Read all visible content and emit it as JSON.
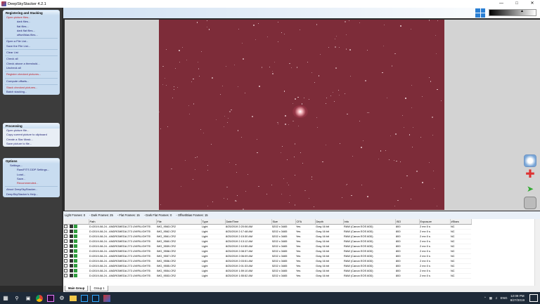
{
  "window": {
    "title": "DeepSkyStacker 4.2.1"
  },
  "sidebar": {
    "registering": {
      "heading": "Registering and Stacking",
      "items": [
        {
          "label": "Open picture files...",
          "indent": 0,
          "red": true
        },
        {
          "label": "dark files...",
          "indent": 2
        },
        {
          "label": "flat files...",
          "indent": 2
        },
        {
          "label": "dark flat files...",
          "indent": 2
        },
        {
          "label": "offset/bias files...",
          "indent": 2
        },
        {
          "sep": true
        },
        {
          "label": "Open a File List...",
          "indent": 0
        },
        {
          "label": "Save the File List...",
          "indent": 0
        },
        {
          "sep": true
        },
        {
          "label": "Clear List",
          "indent": 0
        },
        {
          "sep": true
        },
        {
          "label": "Check all",
          "indent": 0
        },
        {
          "label": "Check above a threshold...",
          "indent": 0
        },
        {
          "label": "Uncheck all",
          "indent": 0
        },
        {
          "sep": true
        },
        {
          "label": "Register checked pictures...",
          "indent": 0,
          "red": true
        },
        {
          "sep": true
        },
        {
          "label": "Compute offsets...",
          "indent": 0
        },
        {
          "sep": true
        },
        {
          "label": "Stack checked pictures...",
          "indent": 0,
          "red": true
        },
        {
          "label": "Batch stacking...",
          "indent": 0
        }
      ]
    },
    "processing": {
      "heading": "Processing",
      "items": [
        {
          "label": "Open picture file...",
          "indent": 0
        },
        {
          "label": "Copy current picture to clipboard",
          "indent": 0
        },
        {
          "label": "Create a Star Mask...",
          "indent": 0
        },
        {
          "label": "Save picture to file...",
          "indent": 0
        }
      ]
    },
    "options": {
      "heading": "Options",
      "items": [
        {
          "label": "Settings...",
          "indent": 1
        },
        {
          "label": "Raw/FITS DDP Settings...",
          "indent": 2
        },
        {
          "label": "Load...",
          "indent": 2
        },
        {
          "label": "Save...",
          "indent": 2
        },
        {
          "label": "Recommended...",
          "indent": 2,
          "red": true
        },
        {
          "sep": true
        },
        {
          "label": "About DeepSkyStacker...",
          "indent": 0
        },
        {
          "label": "DeepSkyStacker's Help...",
          "indent": 0
        }
      ]
    }
  },
  "frames_bar": {
    "light": "Light Frames: 0",
    "dark": "Dark Frames: 25",
    "flat": "Flat Frames: 15",
    "darkflat": "Dark Flat Frames: 0",
    "offset": "Offset/Bias Frames: 15"
  },
  "table": {
    "columns": [
      "Path",
      "File",
      "Type",
      "Date/Time",
      "Size",
      "CFA",
      "Depth",
      "Info",
      "ISO",
      "Exposure",
      "#Stars"
    ],
    "rows": [
      [
        "D:\\2019-08-24 - ANDROMEDA 273 UVIR\\LIGHTS\\",
        "IMG_9563.CR2",
        "Light",
        "8/25/2019 2:20:06 AM",
        "5202 x 3465",
        "Yes",
        "Gray 16 bit",
        "RAW (Canon EOS 60D)",
        "800",
        "2 mn 0 s",
        "NC"
      ],
      [
        "D:\\2019-08-24 - ANDROMEDA 273 UVIR\\LIGHTS\\",
        "IMG_9562.CR2",
        "Light",
        "8/25/2019 2:17:48 AM",
        "5202 x 3465",
        "Yes",
        "Gray 16 bit",
        "RAW (Canon EOS 60D)",
        "800",
        "2 mn 0 s",
        "NC"
      ],
      [
        "D:\\2019-08-24 - ANDROMEDA 273 UVIR\\LIGHTS\\",
        "IMG_9561.CR2",
        "Light",
        "8/25/2019 2:15:30 AM",
        "5202 x 3465",
        "Yes",
        "Gray 16 bit",
        "RAW (Canon EOS 60D)",
        "800",
        "2 mn 0 s",
        "NC"
      ],
      [
        "D:\\2019-08-24 - ANDROMEDA 273 UVIR\\LIGHTS\\",
        "IMG_9560.CR2",
        "Light",
        "8/25/2019 2:13:12 AM",
        "5202 x 3465",
        "Yes",
        "Gray 16 bit",
        "RAW (Canon EOS 60D)",
        "800",
        "2 mn 0 s",
        "NC"
      ],
      [
        "D:\\2019-08-24 - ANDROMEDA 273 UVIR\\LIGHTS\\",
        "IMG_9559.CR2",
        "Light",
        "8/25/2019 2:10:55 AM",
        "5202 x 3465",
        "Yes",
        "Gray 16 bit",
        "RAW (Canon EOS 60D)",
        "800",
        "2 mn 0 s",
        "NC"
      ],
      [
        "D:\\2019-08-24 - ANDROMEDA 273 UVIR\\LIGHTS\\",
        "IMG_9558.CR2",
        "Light",
        "8/25/2019 2:08:37 AM",
        "5202 x 3465",
        "Yes",
        "Gray 16 bit",
        "RAW (Canon EOS 60D)",
        "800",
        "2 mn 0 s",
        "NC"
      ],
      [
        "D:\\2019-08-24 - ANDROMEDA 273 UVIR\\LIGHTS\\",
        "IMG_9557.CR2",
        "Light",
        "8/25/2019 2:06:09 AM",
        "5202 x 3465",
        "Yes",
        "Gray 16 bit",
        "RAW (Canon EOS 60D)",
        "800",
        "2 mn 0 s",
        "NC"
      ],
      [
        "D:\\2019-08-24 - ANDROMEDA 273 UVIR\\LIGHTS\\",
        "IMG_9556.CR2",
        "Light",
        "8/25/2019 2:03:51 AM",
        "5202 x 3465",
        "Yes",
        "Gray 16 bit",
        "RAW (Canon EOS 60D)",
        "800",
        "2 mn 0 s",
        "NC"
      ],
      [
        "D:\\2019-08-24 - ANDROMEDA 273 UVIR\\LIGHTS\\",
        "IMG_9555.CR2",
        "Light",
        "8/25/2019 2:01:33 AM",
        "5202 x 3465",
        "Yes",
        "Gray 16 bit",
        "RAW (Canon EOS 60D)",
        "800",
        "2 mn 0 s",
        "NC"
      ],
      [
        "D:\\2019-08-24 - ANDROMEDA 273 UVIR\\LIGHTS\\",
        "IMG_9554.CR2",
        "Light",
        "8/25/2019 1:59:10 AM",
        "5202 x 3465",
        "Yes",
        "Gray 16 bit",
        "RAW (Canon EOS 60D)",
        "800",
        "2 mn 0 s",
        "NC"
      ],
      [
        "D:\\2019-08-24 - ANDROMEDA 273 UVIR\\LIGHTS\\",
        "IMG_9553.CR2",
        "Light",
        "8/25/2019 1:55:52 AM",
        "5202 x 3465",
        "Yes",
        "Gray 16 bit",
        "RAW (Canon EOS 60D)",
        "800",
        "2 mn 0 s",
        "NC"
      ]
    ]
  },
  "group_tabs": [
    "Main Group",
    "Group 1"
  ],
  "taskbar": {
    "clock_time": "12:09 PM",
    "clock_date": "8/27/2019",
    "language": "ENG",
    "icons": [
      "windows-icon",
      "search-icon",
      "task-view-icon",
      "chrome-icon",
      "premiere-icon",
      "settings-icon",
      "explorer-icon",
      "photoshop-icon",
      "photoshop-icon-2",
      "deepskystacker-icon"
    ]
  },
  "colors": {
    "image_bg": "#7d2c39",
    "panel_bg": "#c8dcf0",
    "link": "#1a1a6e",
    "link_red": "#c0222a"
  }
}
